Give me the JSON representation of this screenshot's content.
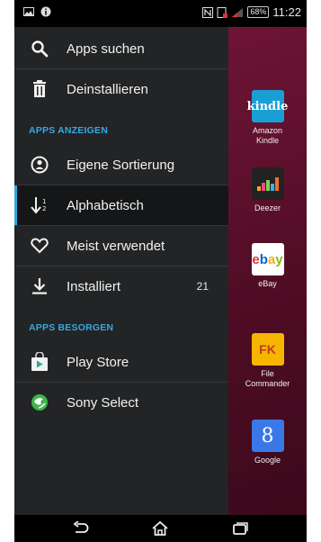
{
  "status_bar": {
    "battery": "68%",
    "time": "11:22",
    "icons": [
      "image-icon",
      "info-icon",
      "nfc-icon",
      "signal-icon",
      "battery-icon"
    ]
  },
  "drawer": {
    "items_top": [
      {
        "label": "Apps suchen",
        "icon": "search-icon"
      },
      {
        "label": "Deinstallieren",
        "icon": "trash-icon"
      }
    ],
    "section_show": "APPS ANZEIGEN",
    "items_show": [
      {
        "label": "Eigene Sortierung",
        "icon": "custom-sort-icon"
      },
      {
        "label": "Alphabetisch",
        "icon": "alpha-sort-icon",
        "selected": true
      },
      {
        "label": "Meist verwendet",
        "icon": "heart-icon"
      },
      {
        "label": "Installiert",
        "icon": "download-icon",
        "count": "21"
      }
    ],
    "section_get": "APPS BESORGEN",
    "items_get": [
      {
        "label": "Play Store",
        "icon": "play-store-icon"
      },
      {
        "label": "Sony Select",
        "icon": "sony-select-icon"
      }
    ]
  },
  "home_apps": [
    {
      "name": "Amazon Kindle",
      "tile_text": "kindle",
      "color": "#1a9fd5"
    },
    {
      "name": "Deezer",
      "tile_text": "",
      "color": "#222"
    },
    {
      "name": "eBay",
      "tile_text": "ebay",
      "color": "#ffffff"
    },
    {
      "name": "File Commander",
      "tile_text": "FK",
      "color": "#f7b500"
    },
    {
      "name": "Google",
      "tile_text": "8",
      "color": "#3b78e7"
    }
  ],
  "colors": {
    "accent": "#36a9e1",
    "drawer_bg": "#232425",
    "home_bg": "#5a0f2a"
  }
}
